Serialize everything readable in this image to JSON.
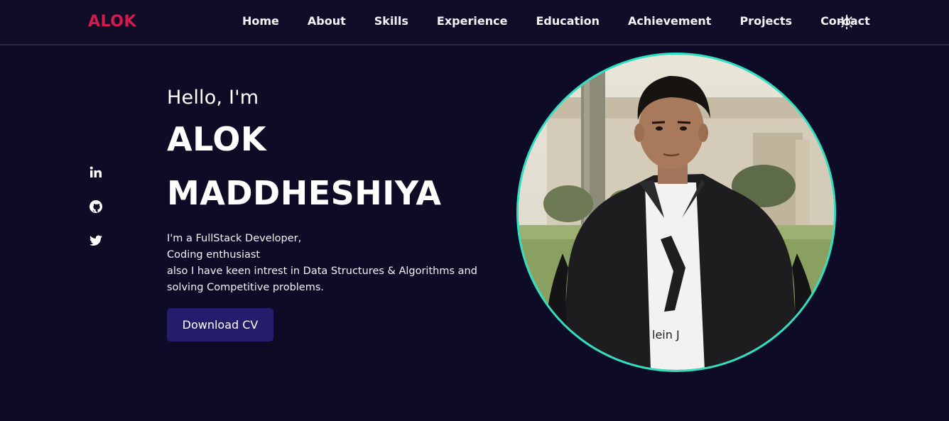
{
  "brand": {
    "logo": "ALOK"
  },
  "nav": {
    "items": [
      {
        "label": "Home"
      },
      {
        "label": "About"
      },
      {
        "label": "Skills"
      },
      {
        "label": "Experience"
      },
      {
        "label": "Education"
      },
      {
        "label": "Achievement"
      },
      {
        "label": "Projects"
      },
      {
        "label": "Contact"
      }
    ],
    "theme_toggle_icon": "sun-icon"
  },
  "socials": [
    {
      "icon": "linkedin-icon"
    },
    {
      "icon": "github-icon"
    },
    {
      "icon": "twitter-icon"
    }
  ],
  "hero": {
    "greeting": "Hello, I'm",
    "first_name": "ALOK",
    "last_name": "MADDHESHIYA",
    "bio": [
      "I'm a FullStack Developer,",
      "Coding enthusiast",
      "also I have keen intrest in Data Structures & Algorithms and",
      "solving Competitive problems."
    ],
    "cta_label": "Download CV"
  },
  "profile_photo": {
    "printed_text": "lein J"
  },
  "colors": {
    "background": "#0e0b26",
    "logo": "#d61a4b",
    "button": "#231d6b",
    "photo_ring": "#2ee0c2"
  }
}
